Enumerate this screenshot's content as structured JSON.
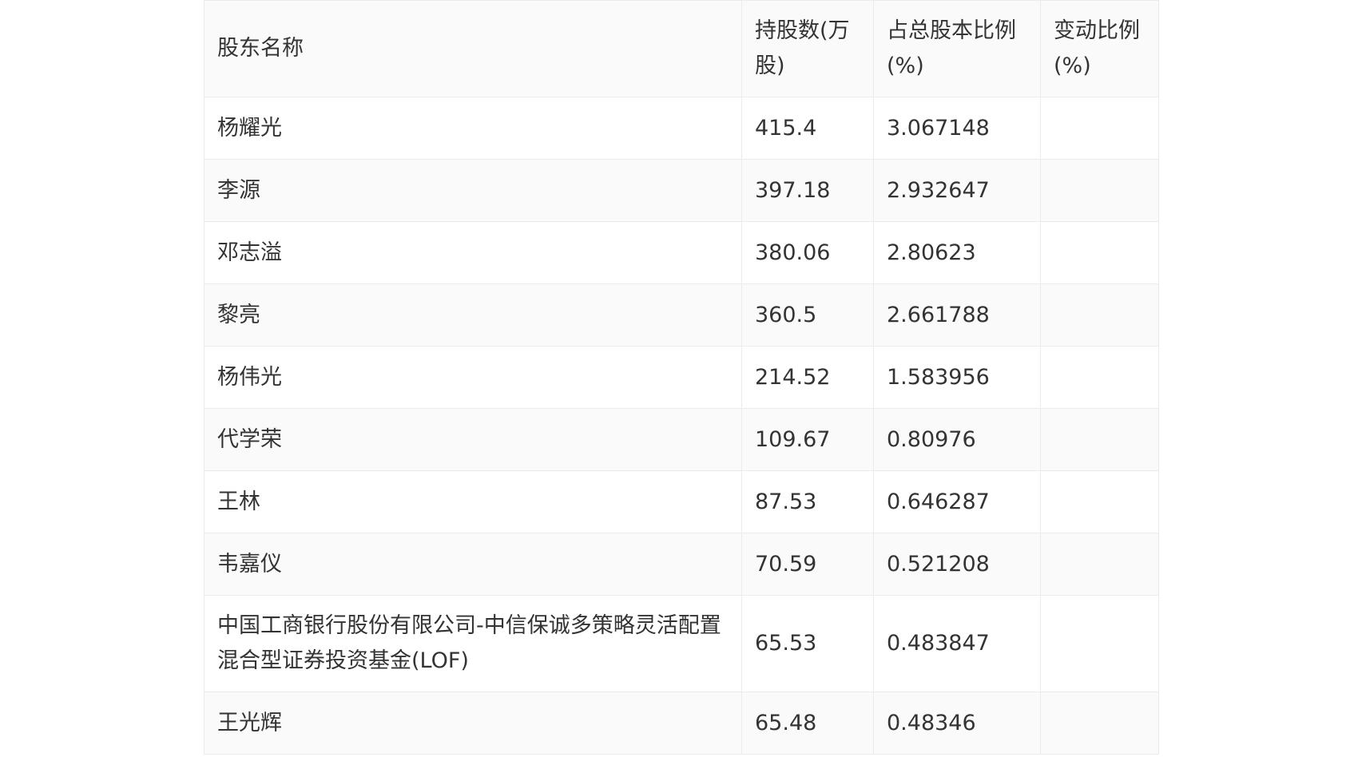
{
  "table": {
    "headers": [
      "股东名称",
      "持股数(万股)",
      "占总股本比例(%)",
      "变动比例(%)"
    ],
    "rows": [
      {
        "name": "杨耀光",
        "shares": "415.4",
        "ratio": "3.067148",
        "change": ""
      },
      {
        "name": "李源",
        "shares": "397.18",
        "ratio": "2.932647",
        "change": ""
      },
      {
        "name": "邓志溢",
        "shares": "380.06",
        "ratio": "2.80623",
        "change": ""
      },
      {
        "name": "黎亮",
        "shares": "360.5",
        "ratio": "2.661788",
        "change": ""
      },
      {
        "name": "杨伟光",
        "shares": "214.52",
        "ratio": "1.583956",
        "change": ""
      },
      {
        "name": "代学荣",
        "shares": "109.67",
        "ratio": "0.80976",
        "change": ""
      },
      {
        "name": "王林",
        "shares": "87.53",
        "ratio": "0.646287",
        "change": ""
      },
      {
        "name": "韦嘉仪",
        "shares": "70.59",
        "ratio": "0.521208",
        "change": ""
      },
      {
        "name": "中国工商银行股份有限公司-中信保诚多策略灵活配置混合型证券投资基金(LOF)",
        "shares": "65.53",
        "ratio": "0.483847",
        "change": ""
      },
      {
        "name": "王光辉",
        "shares": "65.48",
        "ratio": "0.48346",
        "change": ""
      }
    ]
  }
}
